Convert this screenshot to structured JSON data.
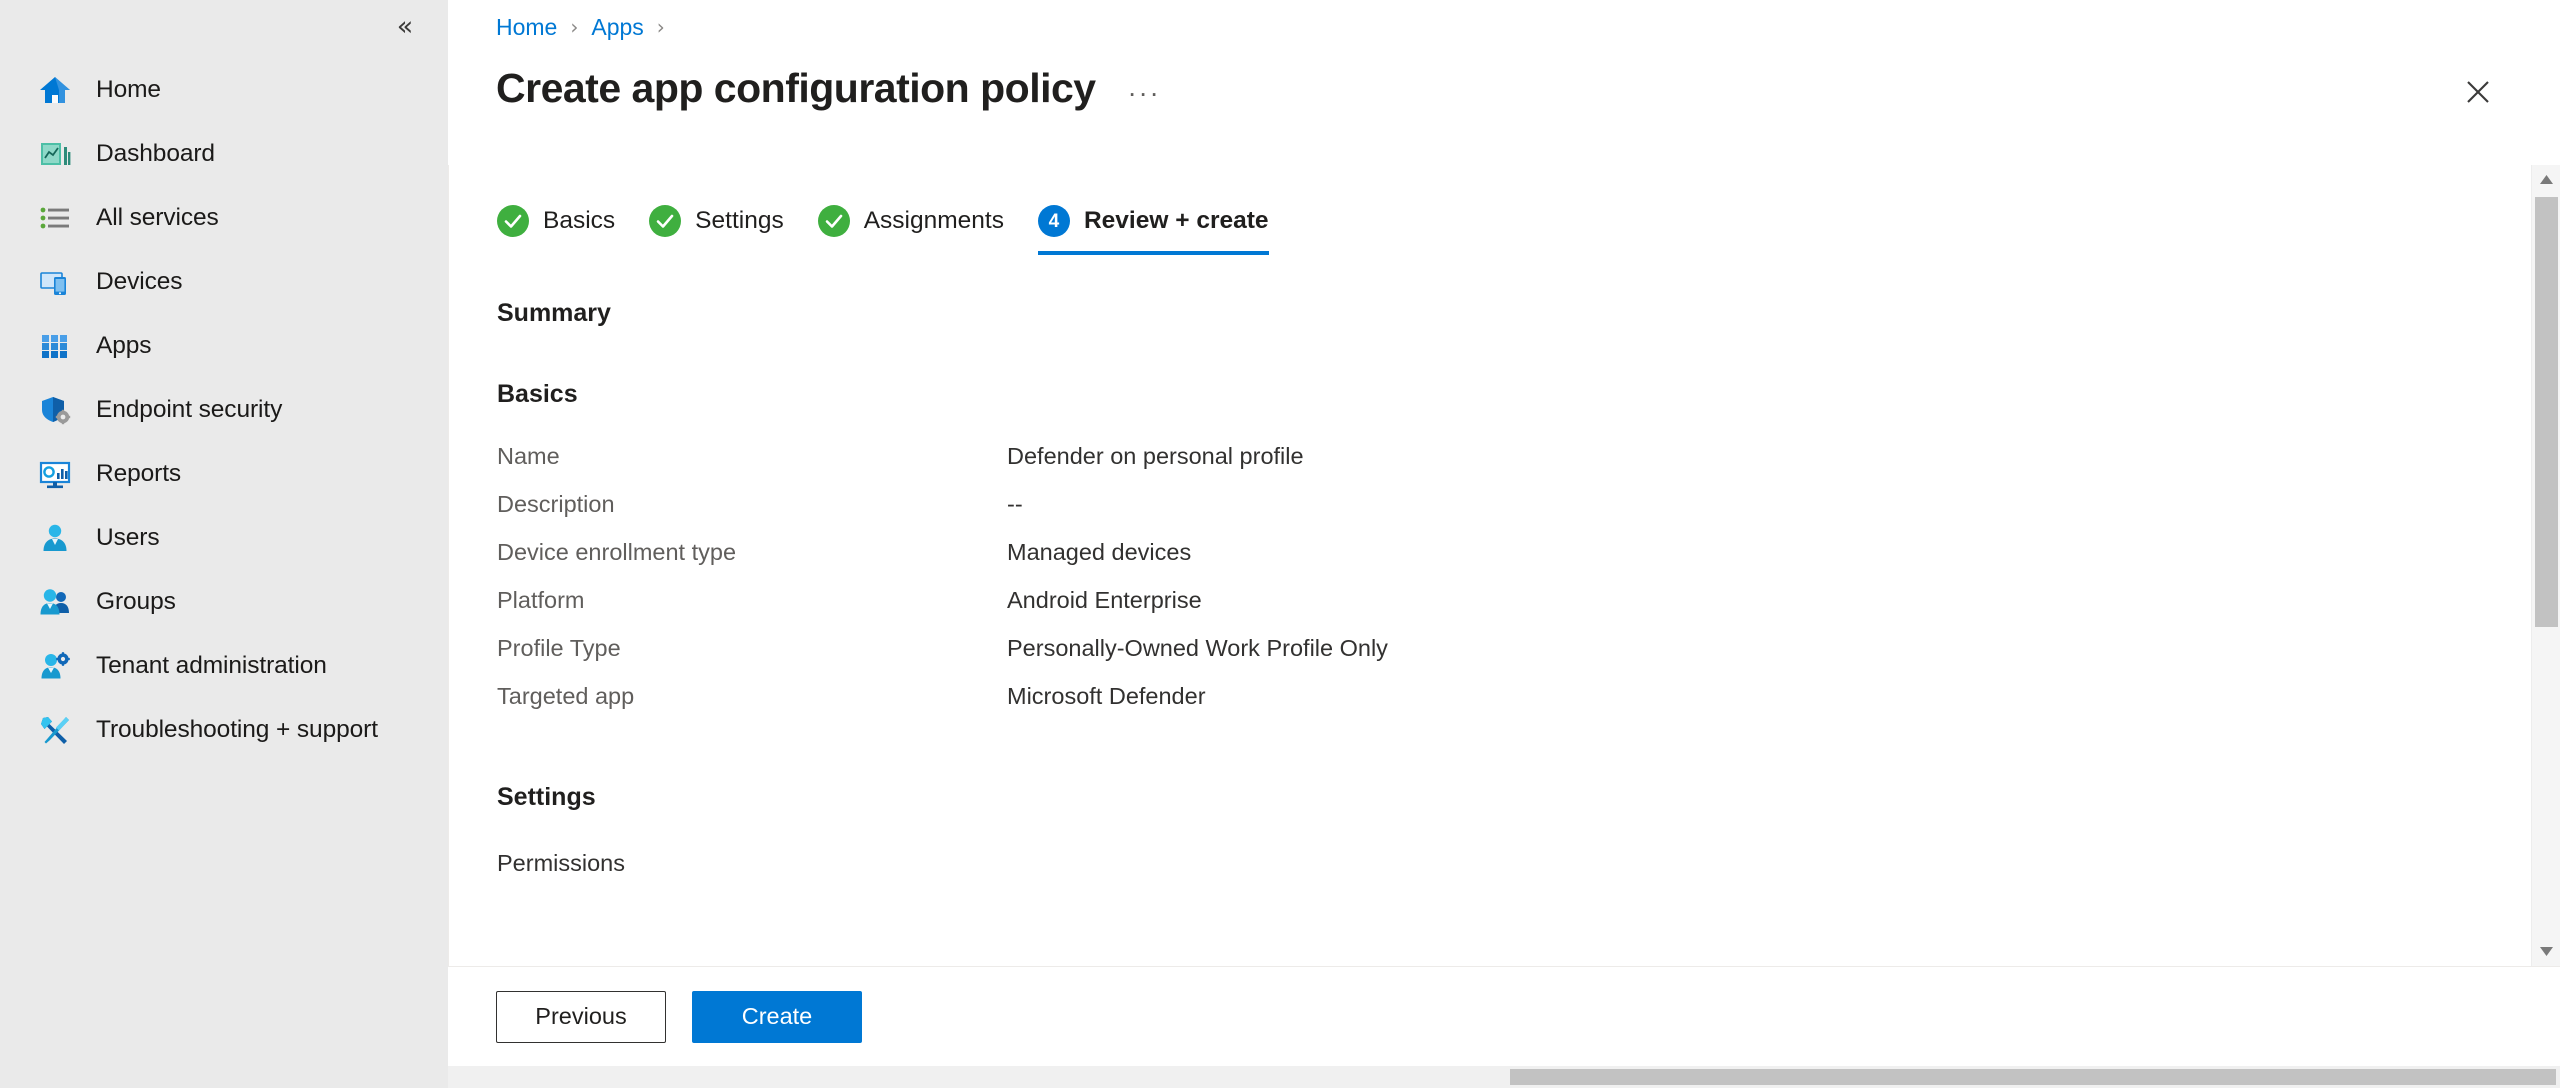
{
  "sidebar": {
    "collapse_icon": "chevron-double-left-icon",
    "items": [
      {
        "label": "Home",
        "icon": "home-icon"
      },
      {
        "label": "Dashboard",
        "icon": "dashboard-icon"
      },
      {
        "label": "All services",
        "icon": "all-services-icon"
      },
      {
        "label": "Devices",
        "icon": "devices-icon"
      },
      {
        "label": "Apps",
        "icon": "apps-grid-icon"
      },
      {
        "label": "Endpoint security",
        "icon": "shield-gear-icon"
      },
      {
        "label": "Reports",
        "icon": "reports-monitor-icon"
      },
      {
        "label": "Users",
        "icon": "user-icon"
      },
      {
        "label": "Groups",
        "icon": "groups-icon"
      },
      {
        "label": "Tenant administration",
        "icon": "user-gear-icon"
      },
      {
        "label": "Troubleshooting + support",
        "icon": "wrench-screwdriver-icon"
      }
    ]
  },
  "breadcrumb": {
    "items": [
      "Home",
      "Apps"
    ],
    "separator": "›"
  },
  "header": {
    "title": "Create app configuration policy",
    "ellipsis": "···",
    "close_icon": "close-icon"
  },
  "wizard": {
    "tabs": [
      {
        "label": "Basics",
        "state": "done",
        "number": "1"
      },
      {
        "label": "Settings",
        "state": "done",
        "number": "2"
      },
      {
        "label": "Assignments",
        "state": "done",
        "number": "3"
      },
      {
        "label": "Review + create",
        "state": "active",
        "number": "4"
      }
    ]
  },
  "main": {
    "summary_heading": "Summary",
    "basics_heading": "Basics",
    "basics_rows": [
      {
        "key": "Name",
        "value": "Defender on personal profile"
      },
      {
        "key": "Description",
        "value": "--"
      },
      {
        "key": "Device enrollment type",
        "value": "Managed devices"
      },
      {
        "key": "Platform",
        "value": "Android Enterprise"
      },
      {
        "key": "Profile Type",
        "value": "Personally-Owned Work Profile Only"
      },
      {
        "key": "Targeted app",
        "value": "Microsoft Defender"
      }
    ],
    "settings_heading": "Settings",
    "permissions_label": "Permissions"
  },
  "footer": {
    "previous_label": "Previous",
    "create_label": "Create"
  },
  "colors": {
    "accent": "#0078d4",
    "success": "#3faf3f",
    "sidebar_bg": "#eaeaea",
    "text_primary": "#201f1e",
    "text_secondary": "#605e5c"
  }
}
